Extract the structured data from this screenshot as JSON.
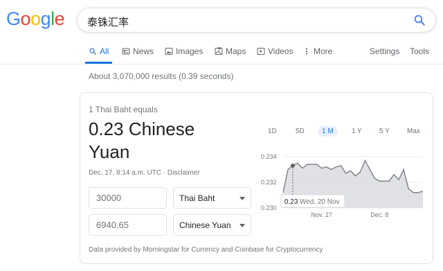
{
  "logo": {
    "letters": [
      "G",
      "o",
      "o",
      "g",
      "l",
      "e"
    ],
    "colors": [
      "#4285f4",
      "#ea4335",
      "#fbbc05",
      "#4285f4",
      "#34a853",
      "#ea4335"
    ]
  },
  "search": {
    "query": "泰铢汇率",
    "icon": "search-icon"
  },
  "tabs": [
    {
      "label": "All",
      "icon": "search-icon",
      "active": true
    },
    {
      "label": "News",
      "icon": "news-icon"
    },
    {
      "label": "Images",
      "icon": "image-icon"
    },
    {
      "label": "Maps",
      "icon": "map-icon"
    },
    {
      "label": "Videos",
      "icon": "play-icon"
    },
    {
      "label": "More",
      "icon": "more-icon"
    },
    {
      "label": "Settings"
    },
    {
      "label": "Tools"
    }
  ],
  "stats": "About 3,070,000 results (0.39 seconds)",
  "converter": {
    "equals_label": "1 Thai Baht equals",
    "result_line1": "0.23 Chinese",
    "result_line2": "Yuan",
    "timestamp": "Dec. 17, 8:14 a.m. UTC · Disclaimer",
    "from_amount": "30000",
    "from_currency": "Thai Baht",
    "to_amount": "6940.65",
    "to_currency": "Chinese Yuan",
    "credit": "Data provided by Morningstar for Currency and Coinbase for Cryptocurrency"
  },
  "ranges": [
    "1D",
    "5D",
    "1 M",
    "1 Y",
    "5 Y",
    "Max"
  ],
  "active_range": "1 M",
  "chart_data": {
    "type": "area",
    "y_ticks": [
      "0.234",
      "0.232",
      "0.230"
    ],
    "ylim": [
      0.23,
      0.234
    ],
    "x_ticks": [
      "Nov. 27",
      "Dec. 8"
    ],
    "values": [
      0.2312,
      0.233,
      0.2333,
      0.2335,
      0.2331,
      0.2334,
      0.2334,
      0.2334,
      0.2331,
      0.2332,
      0.233,
      0.2332,
      0.2333,
      0.2327,
      0.2329,
      0.2325,
      0.2328,
      0.2337,
      0.233,
      0.2323,
      0.2321,
      0.2321,
      0.2321,
      0.2326,
      0.2322,
      0.233,
      0.2315,
      0.2312,
      0.2312,
      0.2313
    ],
    "tooltip": {
      "value": "0.23",
      "date": "Wed, 20 Nov",
      "index": 2
    },
    "fill": "#dadce0",
    "line": "#80868b"
  }
}
